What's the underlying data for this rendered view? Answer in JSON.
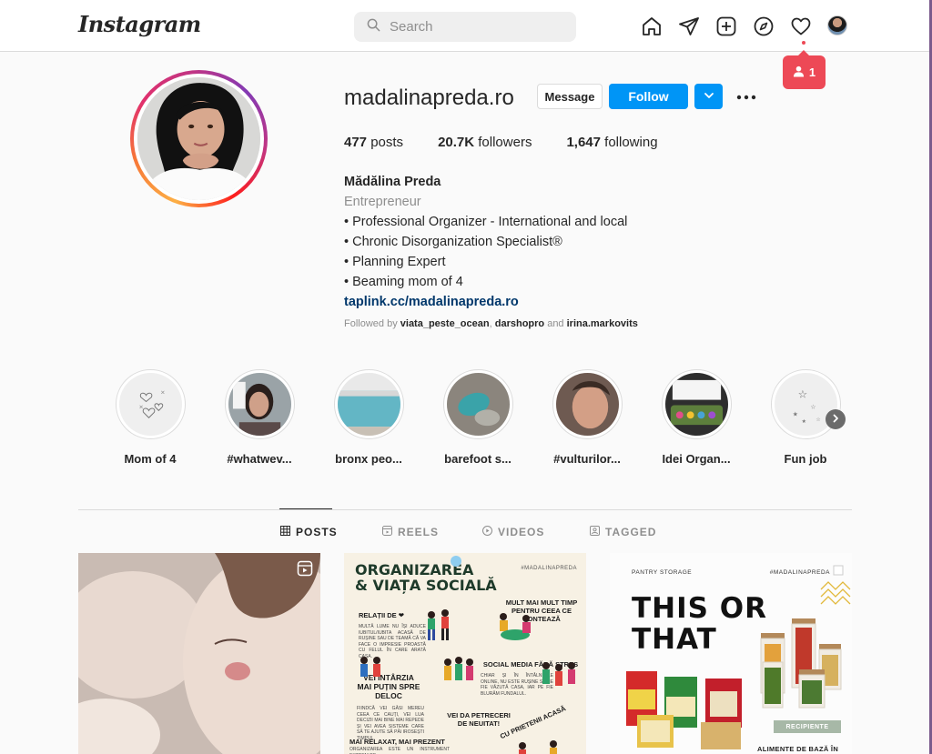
{
  "header": {
    "logo_text": "Instagram",
    "search_placeholder": "Search",
    "nav_icons": [
      "home-icon",
      "direct-icon",
      "new-post-icon",
      "explore-icon",
      "activity-heart-icon",
      "profile-avatar"
    ],
    "notification": {
      "icon": "person-icon",
      "count": "1"
    }
  },
  "profile": {
    "username": "madalinapreda.ro",
    "buttons": {
      "message": "Message",
      "follow": "Follow"
    },
    "stats": {
      "posts_count": "477",
      "posts_label": " posts",
      "followers_count": "20.7K",
      "followers_label": " followers",
      "following_count": "1,647",
      "following_label": " following"
    },
    "full_name": "Mădălina Preda",
    "category": "Entrepreneur",
    "bio_lines": [
      "• Professional Organizer - International and local",
      "• Chronic Disorganization Specialist®",
      "• Planning Expert",
      "• Beaming mom of 4"
    ],
    "link": "taplink.cc/madalinapreda.ro",
    "followed_by": {
      "prefix": "Followed by ",
      "users": [
        "viata_peste_ocean",
        "darshopro",
        "irina.markovits"
      ],
      "sep1": ", ",
      "sep2": " and "
    }
  },
  "highlights": [
    {
      "label": "Mom of 4"
    },
    {
      "label": "#whatwev..."
    },
    {
      "label": "bronx peo..."
    },
    {
      "label": "barefoot s..."
    },
    {
      "label": "#vulturilor..."
    },
    {
      "label": "Idei Organ..."
    },
    {
      "label": "Fun job"
    }
  ],
  "tabs": [
    {
      "label": "POSTS",
      "icon": "grid-icon",
      "active": true
    },
    {
      "label": "REELS",
      "icon": "reels-icon",
      "active": false
    },
    {
      "label": "VIDEOS",
      "icon": "play-icon",
      "active": false
    },
    {
      "label": "TAGGED",
      "icon": "tag-icon",
      "active": false
    }
  ],
  "posts": {
    "post2": {
      "title_line1": "ORGANIZAREA",
      "title_line2": "& VIAȚA SOCIALĂ",
      "hashtag": "#MADALINAPREDA",
      "h_relatii": "RELAȚII DE ❤",
      "h_mult": "MULT MAI MULT TIMP PENTRU CEEA CE CONTEAZĂ",
      "h_social": "SOCIAL MEDIA FĂRĂ STRES",
      "h_vei_intarzia": "VEI ÎNTÂRZIA MAI PUȚIN SPRE DELOC",
      "h_petreceri": "VEI DA PETRECERI DE NEUITAT!",
      "h_relaxat": "MAI RELAXAT, MAI PREZENT",
      "h_prieteni": "CU PRIETENII ACASĂ",
      "body_relatii": "MULTĂ LUME NU ÎȘI ADUCE IUBITUL/IUBITA ACASĂ DE RUȘINE SAU DE TEAMĂ CĂ VA FACE O IMPRESIE PROASTĂ CU FELUL ÎN CARE ARATĂ CASA.",
      "body_social": "CHIAR ȘI ÎN ÎNTÂLNIRILE ONLINE, NU ESTE RUȘINE SĂ NE FIE VĂZUTĂ CASA, IAR PE FIE BLURĂM FUNDALUL.",
      "body_vei": "FIINDCĂ VEI GĂSI MEREU CEEA CE CAUȚI, VEI LUA DECIZII MAI BINE MAI REPEDE ȘI VEI AVEA SISTEME CARE SĂ TE AJUTE SĂ PĂI IROSEȘTI TIMPUL.",
      "body_relaxat": "ORGANIZAREA ESTE UN INSTRUMENT EXTREM DE"
    },
    "post3": {
      "label_left": "PANTRY STORAGE",
      "hashtag": "#MADALINAPREDA",
      "title_line1": "THIS OR",
      "title_line2": "THAT",
      "badge": "RECIPIENTE",
      "footer": "ALIMENTE DE BAZĂ ÎN"
    }
  },
  "colors": {
    "follow_blue": "#0095f6",
    "link_blue": "#00376b",
    "notification_red": "#ed4956",
    "text_primary": "#262626",
    "text_secondary": "#8e8e8e"
  }
}
